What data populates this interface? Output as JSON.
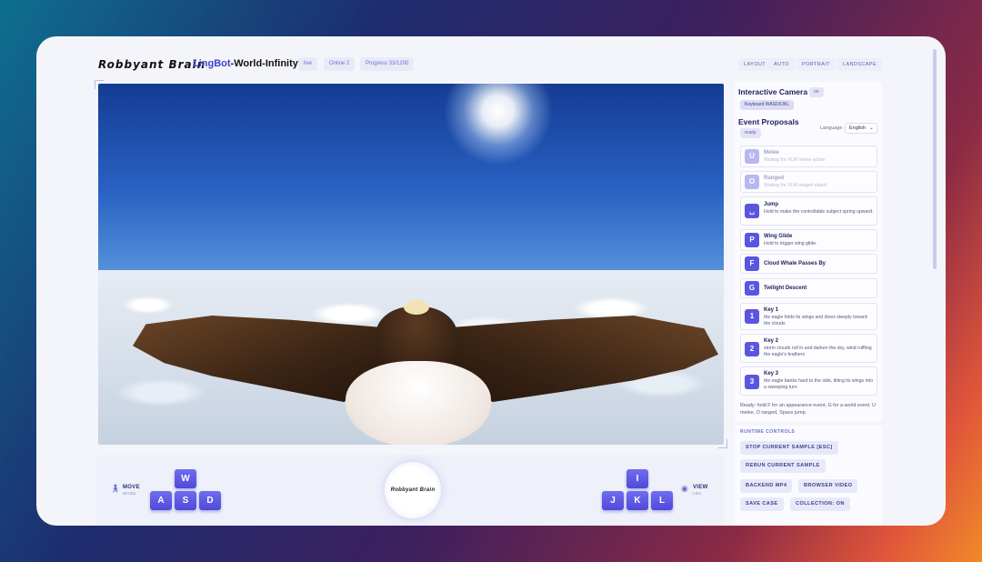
{
  "header": {
    "logo": "Robbyant Brain",
    "title_part1": "LingBot",
    "title_part2": "-World-Infinity",
    "title_symbol": "∞",
    "status_live": "live",
    "status_online": "Online 2",
    "status_progress": "Progress 33/1200",
    "layout_buttons": [
      "LAYOUT",
      "AUTO",
      "PORTRAIT",
      "LANDSCAPE"
    ]
  },
  "controls": {
    "move_label": "MOVE",
    "move_sub": "WASD",
    "view_label": "VIEW",
    "view_sub": "IJKL",
    "move_keys": [
      "W",
      "A",
      "S",
      "D"
    ],
    "view_keys": [
      "I",
      "J",
      "K",
      "L"
    ],
    "center_logo": "Robbyant Brain"
  },
  "panel": {
    "camera_title": "Interactive Camera",
    "camera_status": "on",
    "camera_hint": "Keyboard WASD/IJKL",
    "events_title": "Event Proposals",
    "events_status": "ready",
    "language_label": "Language",
    "language_value": "English",
    "events": [
      {
        "key": "U",
        "name": "Melee",
        "desc": "Waiting for VLM melee action"
      },
      {
        "key": "O",
        "name": "Ranged",
        "desc": "Waiting for VLM ranged attack"
      },
      {
        "key": "␣",
        "name": "Jump",
        "desc": "Hold to make the controllable subject spring upward."
      },
      {
        "key": "P",
        "name": "Wing Glide",
        "desc": "Hold to trigger wing glide."
      },
      {
        "key": "F",
        "name": "Cloud Whale Passes By",
        "desc": ""
      },
      {
        "key": "G",
        "name": "Twilight Descent",
        "desc": ""
      },
      {
        "key": "1",
        "name": "Key 1",
        "desc": "the eagle folds its wings and dives steeply toward the clouds"
      },
      {
        "key": "2",
        "name": "Key 2",
        "desc": "storm clouds roll in and darken the sky, wind ruffling the eagle's feathers"
      },
      {
        "key": "3",
        "name": "Key 3",
        "desc": "the eagle banks hard to the side, tilting its wings into a sweeping turn"
      }
    ],
    "ready_note": "Ready: hold F for an appearance event, G for a world event. U melee, O ranged, Space jump."
  },
  "runtime": {
    "title": "RUNTIME CONTROLS",
    "stop": "STOP CURRENT SAMPLE [ESC]",
    "rerun": "RERUN CURRENT SAMPLE",
    "backend_mp4": "BACKEND MP4",
    "browser_video": "BROWSER VIDEO",
    "save_case": "SAVE CASE",
    "collection": "COLLECTION: ON"
  },
  "colors": {
    "accent": "#5b55e0",
    "title_blue": "#3d43c8"
  }
}
